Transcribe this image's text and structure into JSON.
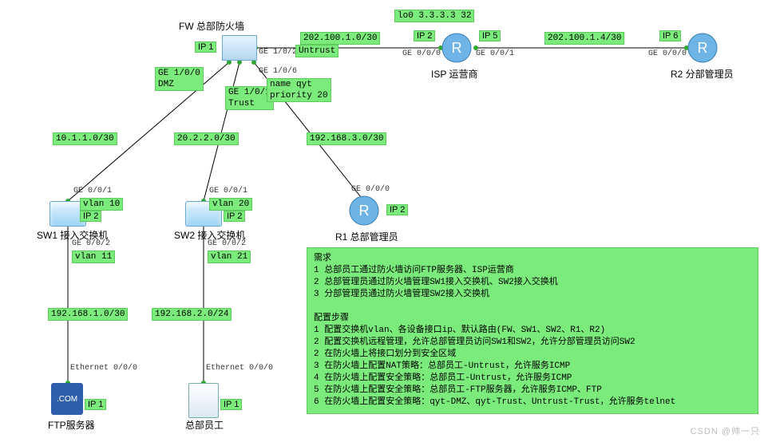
{
  "title_fw": "FW 总部防火墙",
  "title_isp": "ISP 运营商",
  "title_r2": "R2 分部管理员",
  "title_sw1": "SW1 接入交换机",
  "title_sw2": "SW2 接入交换机",
  "title_r1": "R1 总部管理员",
  "title_ftp": "FTP服务器",
  "title_emp": "总部员工",
  "watermark": "CSDN @帅一只",
  "ip_1": "IP 1",
  "ip_2": "IP 2",
  "ip_5": "IP 5",
  "ip_6": "IP 6",
  "fw_ge102": "GE 1/0/2",
  "fw_untrust": "Untrust",
  "fw_ge100_dmz": "GE 1/0/0\nDMZ",
  "fw_ge101_trust": "GE 1/0/1\nTrust",
  "fw_ge106": "GE 1/0/6",
  "fw_qyt": "name qyt\npriority 20",
  "lo0": "lo0 3.3.3.3 32",
  "isp_ge000": "GE 0/0/0",
  "isp_ge001": "GE 0/0/1",
  "r2_ge000": "GE 0/0/0",
  "sw1_ge001": "GE 0/0/1",
  "sw1_vlan10": "vlan 10",
  "sw1_ge002": "GE 0/0/2",
  "sw1_vlan11": "vlan 11",
  "sw2_ge001": "GE 0/0/1",
  "sw2_vlan20": "vlan 20",
  "sw2_ge002": "GE 0/0/2",
  "sw2_vlan21": "vlan 21",
  "r1_ge000": "GE 0/0/0",
  "eth000_a": "Ethernet 0/0/0",
  "eth000_b": "Ethernet 0/0/0",
  "net_fw_isp": "202.100.1.0/30",
  "net_isp_r2": "202.100.1.4/30",
  "net_fw_sw1": "10.1.1.0/30",
  "net_fw_sw2": "20.2.2.0/30",
  "net_fw_r1": "192.168.3.0/30",
  "net_sw1_ftp": "192.168.1.0/30",
  "net_sw2_emp": "192.168.2.0/24",
  "panel": {
    "hdr1": "需求",
    "r1": "1 总部员工通过防火墙访问FTP服务器、ISP运营商",
    "r2": "2 总部管理员通过防火墙管理SW1接入交换机、SW2接入交换机",
    "r3": "3 分部管理员通过防火墙管理SW2接入交换机",
    "hdr2": "配置步骤",
    "s1": "1 配置交换机vlan、各设备接口ip、默认路由(FW、SW1、SW2、R1、R2)",
    "s2": "2 配置交换机远程管理，允许总部管理员访问SW1和SW2，允许分部管理员访问SW2",
    "s3": "2 在防火墙上将接口划分到安全区域",
    "s4": "3 在防火墙上配置NAT策略：总部员工-Untrust，允许服务ICMP",
    "s5": "4 在防火墙上配置安全策略：总部员工-Untrust，允许服务ICMP",
    "s6": "5 在防火墙上配置安全策略：总部员工-FTP服务器，允许服务ICMP、FTP",
    "s7": "6 在防火墙上配置安全策略：qyt-DMZ、qyt-Trust、Untrust-Trust，允许服务telnet"
  },
  "chart_data": {
    "type": "network-diagram",
    "nodes": [
      {
        "id": "FW",
        "label": "FW 总部防火墙",
        "kind": "firewall",
        "ip": "IP 1"
      },
      {
        "id": "ISP",
        "label": "ISP 运营商",
        "kind": "router",
        "ip_left": "IP 2",
        "ip_right": "IP 5",
        "loopback": "3.3.3.3/32"
      },
      {
        "id": "R2",
        "label": "R2 分部管理员",
        "kind": "router",
        "ip": "IP 6"
      },
      {
        "id": "SW1",
        "label": "SW1 接入交换机",
        "kind": "switch",
        "ip": "IP 2",
        "vlans": [
          "10",
          "11"
        ]
      },
      {
        "id": "SW2",
        "label": "SW2 接入交换机",
        "kind": "switch",
        "ip": "IP 2",
        "vlans": [
          "20",
          "21"
        ]
      },
      {
        "id": "R1",
        "label": "R1 总部管理员",
        "kind": "router",
        "ip": "IP 2"
      },
      {
        "id": "FTP",
        "label": "FTP服务器",
        "kind": "server",
        "ip": "IP 1"
      },
      {
        "id": "EMP",
        "label": "总部员工",
        "kind": "host",
        "ip": "IP 1"
      }
    ],
    "links": [
      {
        "a": "FW",
        "a_if": "GE 1/0/2",
        "a_zone": "Untrust",
        "b": "ISP",
        "b_if": "GE 0/0/0",
        "subnet": "202.100.1.0/30"
      },
      {
        "a": "ISP",
        "a_if": "GE 0/0/1",
        "b": "R2",
        "b_if": "GE 0/0/0",
        "subnet": "202.100.1.4/30"
      },
      {
        "a": "FW",
        "a_if": "GE 1/0/0",
        "a_zone": "DMZ",
        "b": "SW1",
        "b_if": "GE 0/0/1",
        "b_vlan": "10",
        "subnet": "10.1.1.0/30"
      },
      {
        "a": "FW",
        "a_if": "GE 1/0/1",
        "a_zone": "Trust",
        "b": "SW2",
        "b_if": "GE 0/0/1",
        "b_vlan": "20",
        "subnet": "20.2.2.0/30"
      },
      {
        "a": "FW",
        "a_if": "GE 1/0/6",
        "a_zone": "qyt",
        "a_zone_priority": 20,
        "b": "R1",
        "b_if": "GE 0/0/0",
        "subnet": "192.168.3.0/30"
      },
      {
        "a": "SW1",
        "a_if": "GE 0/0/2",
        "a_vlan": "11",
        "b": "FTP",
        "b_if": "Ethernet 0/0/0",
        "subnet": "192.168.1.0/30"
      },
      {
        "a": "SW2",
        "a_if": "GE 0/0/2",
        "a_vlan": "21",
        "b": "EMP",
        "b_if": "Ethernet 0/0/0",
        "subnet": "192.168.2.0/24"
      }
    ]
  }
}
